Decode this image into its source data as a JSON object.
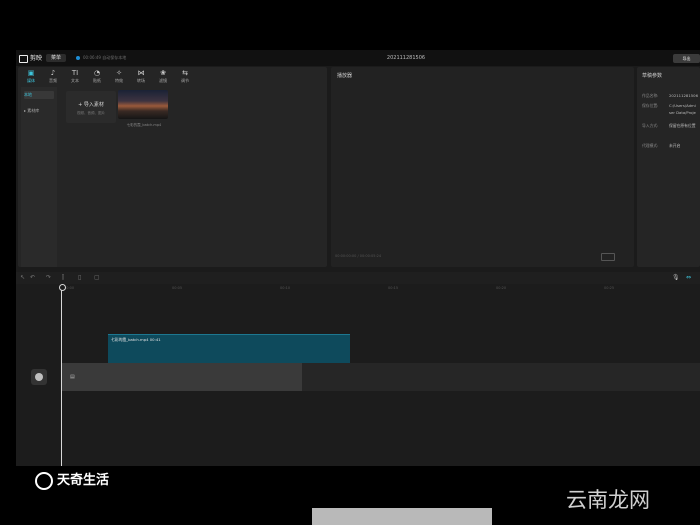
{
  "app": {
    "name": "剪映",
    "menu": "菜单",
    "save_status": "00:06:49 自动保存本地",
    "project_title": "202111281506",
    "export": "导出"
  },
  "toolbar": [
    {
      "label": "媒体",
      "icon": "▣",
      "name": "tool-media"
    },
    {
      "label": "音频",
      "icon": "♪",
      "name": "tool-audio"
    },
    {
      "label": "文本",
      "icon": "TI",
      "name": "tool-text"
    },
    {
      "label": "贴纸",
      "icon": "◔",
      "name": "tool-sticker"
    },
    {
      "label": "特效",
      "icon": "✧",
      "name": "tool-effects"
    },
    {
      "label": "转场",
      "icon": "⋈",
      "name": "tool-transition"
    },
    {
      "label": "滤镜",
      "icon": "❀",
      "name": "tool-filter"
    },
    {
      "label": "调节",
      "icon": "⇆",
      "name": "tool-adjust"
    }
  ],
  "sidebar": {
    "local": "本地",
    "library": "▸ 素材库"
  },
  "media": {
    "import_label": "+ 导入素材",
    "import_sub": "视频、音频、图片",
    "thumb_name": "七彩的霞_batch.mp4"
  },
  "player": {
    "title": "播放器",
    "footer": "00:00:00:00 / 00:00:05:24"
  },
  "props": {
    "title": "草稿参数",
    "rows": [
      {
        "k": "作品名称:",
        "v": "202111281506"
      },
      {
        "k": "保存位置:",
        "v": "C:/Users/Admi"
      },
      {
        "k": "",
        "v": "ser Data/Proje"
      },
      {
        "k": "导入方式:",
        "v": "保留在原有位置"
      },
      {
        "k": "代理模式:",
        "v": "未开启"
      }
    ]
  },
  "timeline": {
    "ruler": [
      "00:00",
      "00:05",
      "00:10",
      "00:15",
      "00:20",
      "00:25"
    ],
    "clip_label": "七彩的霞_batch.mp4  00:41"
  },
  "watermark": {
    "left": "天奇生活",
    "right": "云南龙网"
  }
}
